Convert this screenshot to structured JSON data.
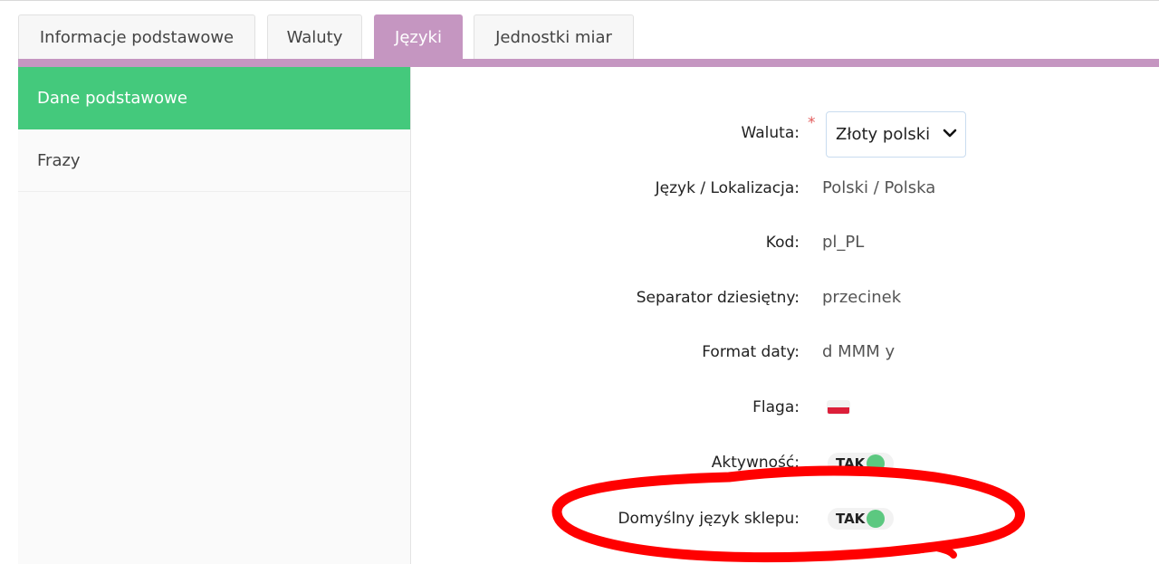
{
  "tabs": [
    {
      "label": "Informacje podstawowe",
      "active": false
    },
    {
      "label": "Waluty",
      "active": false
    },
    {
      "label": "Języki",
      "active": true
    },
    {
      "label": "Jednostki miar",
      "active": false
    }
  ],
  "sidebar": {
    "items": [
      {
        "label": "Dane podstawowe",
        "active": true
      },
      {
        "label": "Frazy",
        "active": false
      }
    ]
  },
  "form": {
    "currency": {
      "label": "Waluta:",
      "value": "Złoty polski",
      "required": true
    },
    "locale": {
      "label": "Język / Lokalizacja:",
      "value": "Polski / Polska"
    },
    "code": {
      "label": "Kod:",
      "value": "pl_PL"
    },
    "decimal_separator": {
      "label": "Separator dziesiętny:",
      "value": "przecinek"
    },
    "date_format": {
      "label": "Format daty:",
      "value": "d MMM y"
    },
    "flag": {
      "label": "Flaga:",
      "icon": "poland-flag-icon"
    },
    "active": {
      "label": "Aktywność:",
      "value": "TAK",
      "on": true
    },
    "default_language": {
      "label": "Domyślny język sklepu:",
      "value": "TAK",
      "on": true
    }
  },
  "colors": {
    "tab_active": "#c596c1",
    "sidebar_active": "#44c97c",
    "toggle_on": "#5cc880",
    "annotation": "#ff0000"
  }
}
